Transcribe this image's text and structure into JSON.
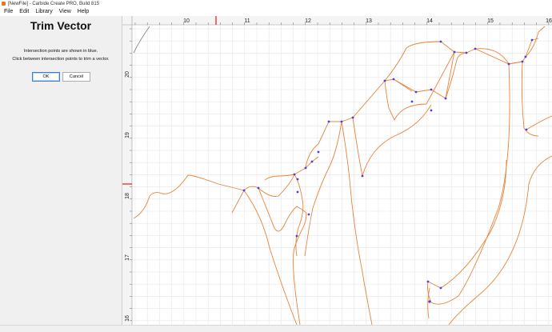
{
  "window": {
    "title": "[NewFile] - Carbide Create PRO, Build 815"
  },
  "menu": {
    "file": "File",
    "edit": "Edit",
    "library": "Library",
    "view": "View",
    "help": "Help"
  },
  "panel": {
    "title": "Trim Vector",
    "line1": "Intersection points are shown in blue.",
    "line2": "Click between intersection points to trim a vector.",
    "ok": "OK",
    "cancel": "Cancel"
  },
  "ruler": {
    "x_labels": [
      "10",
      "11",
      "12",
      "13",
      "14",
      "15",
      "16"
    ],
    "y_labels": [
      "20",
      "19",
      "18",
      "17",
      "16"
    ]
  },
  "colors": {
    "vector": "#e8843a",
    "intersection": "#4b3fe0",
    "grid": "#e6e6e6",
    "marker": "#e01818"
  }
}
